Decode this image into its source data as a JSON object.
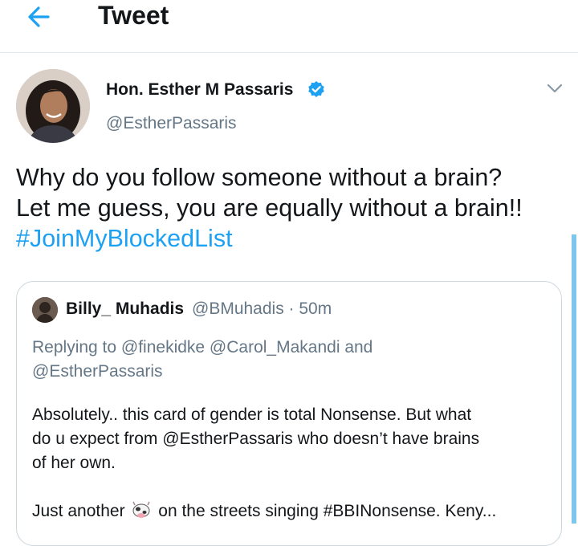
{
  "header": {
    "back_icon": "arrow-left-icon",
    "title": "Tweet"
  },
  "tweet": {
    "author_name": "Hon. Esther M Passaris",
    "verified_icon": "verified-badge-icon",
    "handle": "@EstherPassaris",
    "more_icon": "chevron-down-icon",
    "text_lines": [
      "Why do you follow someone without a brain?",
      "Let me guess, you are equally without a brain!!"
    ],
    "hashtag": "#JoinMyBlockedList"
  },
  "quoted_tweet": {
    "author_name": "Billy_ Muhadis",
    "meta": "@BMuhadis · 50m",
    "reply_lines": [
      "Replying to @finekidke @Carol_Makandi and",
      "@EstherPassaris"
    ],
    "body_lines": [
      "Absolutely.. this card of gender is total Nonsense. But what",
      "do u expect from @EstherPassaris who doesn’t have brains",
      "of her own.",
      ""
    ],
    "last_line_before": "Just another",
    "emoji_icon": "cow-emoji-icon",
    "last_line_after": "on the streets singing #BBINonsense. Keny..."
  },
  "colors": {
    "accent": "#1da1f2",
    "secondary_text": "#657786",
    "border": "#ccd6dd"
  }
}
